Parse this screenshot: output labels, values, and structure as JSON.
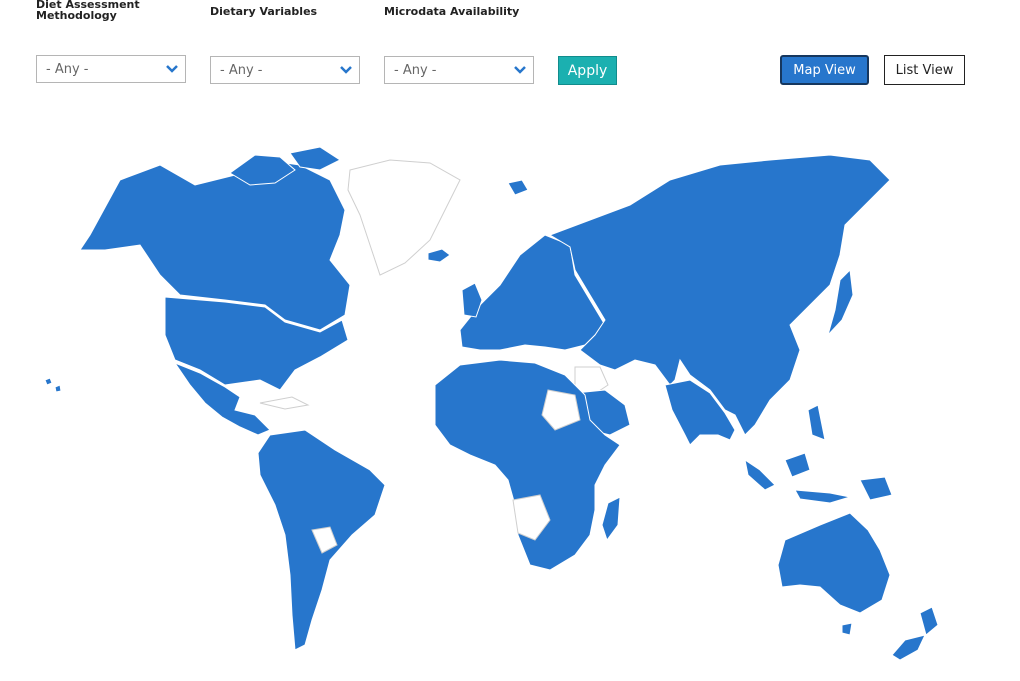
{
  "filters": [
    {
      "label": "Diet Assessment Methodology",
      "value": "- Any -"
    },
    {
      "label": "Dietary Variables",
      "value": "- Any -"
    },
    {
      "label": "Microdata Availability",
      "value": "- Any -"
    }
  ],
  "apply_label": "Apply",
  "views": {
    "map": "Map View",
    "list": "List View",
    "active": "map"
  },
  "colors": {
    "covered": "#2776cc",
    "not_covered": "#ffffff",
    "apply": "#1bb0b0"
  },
  "icons": {
    "dropdown": "chevron-down-icon"
  }
}
